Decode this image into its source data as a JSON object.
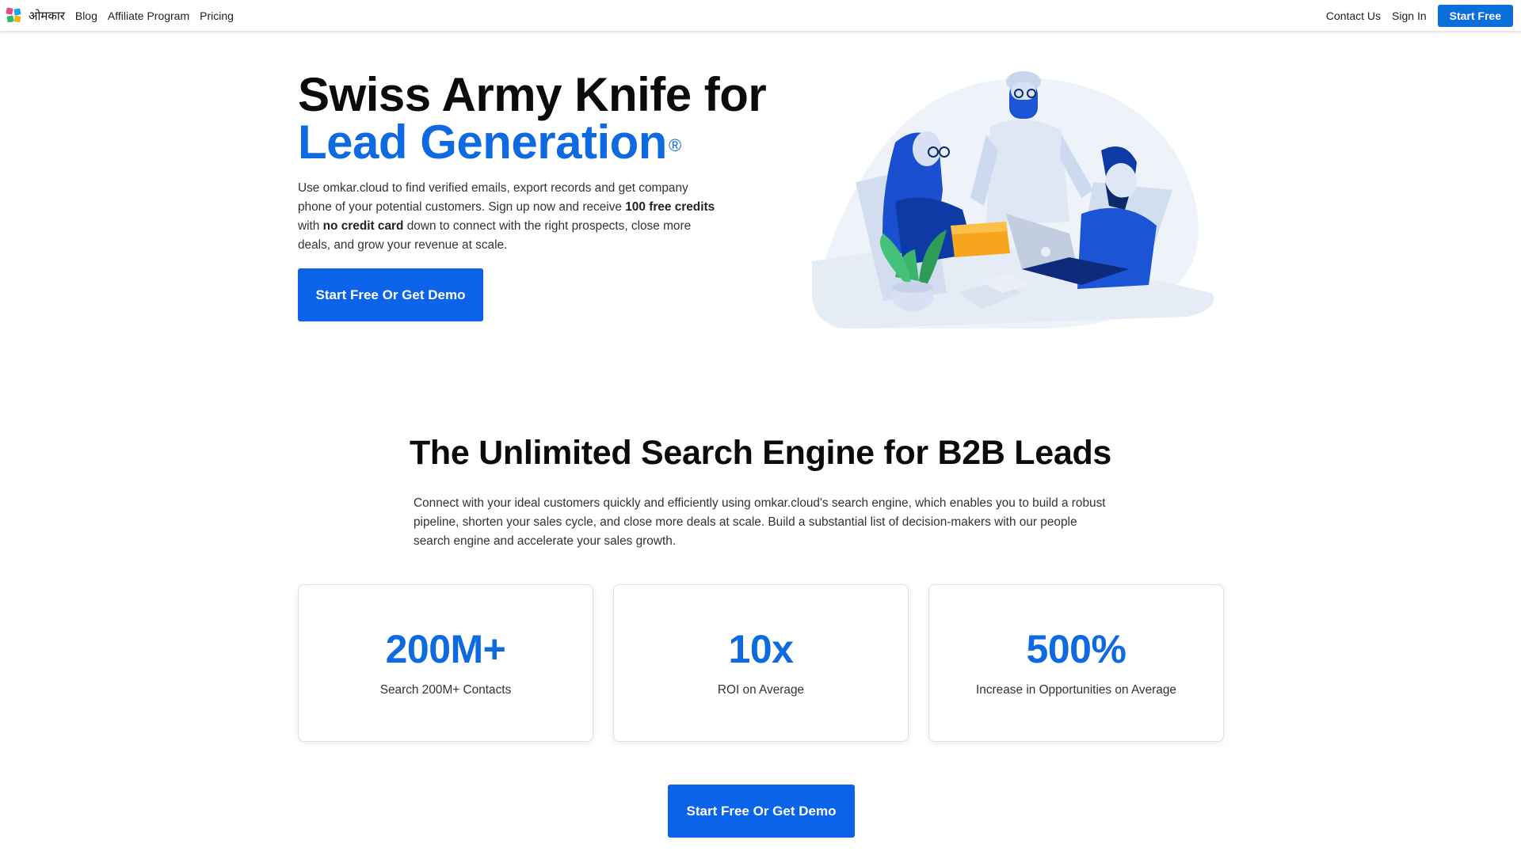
{
  "nav": {
    "brand": "ओमकार",
    "links": [
      "Blog",
      "Affiliate Program",
      "Pricing"
    ],
    "right_links": [
      "Contact Us",
      "Sign In"
    ],
    "cta": "Start Free"
  },
  "hero": {
    "title_line1": "Swiss Army Knife for",
    "title_line2": "Lead Generation",
    "trademark": "®",
    "desc_part1": "Use omkar.cloud to find verified emails, export records and get company phone of your potential customers. Sign up now and receive ",
    "desc_bold1": "100 free credits",
    "desc_part2": " with ",
    "desc_bold2": "no credit card",
    "desc_part3": " down to connect with the right prospects, close more deals, and grow your revenue at scale.",
    "cta": "Start Free Or Get Demo"
  },
  "section": {
    "title": "The Unlimited Search Engine for B2B Leads",
    "desc": "Connect with your ideal customers quickly and efficiently using omkar.cloud's search engine, which enables you to build a robust pipeline, shorten your sales cycle, and close more deals at scale. Build a substantial list of decision-makers with our people search engine and accelerate your sales growth.",
    "stats": [
      {
        "value": "200M+",
        "label": "Search 200M+ Contacts"
      },
      {
        "value": "10x",
        "label": "ROI on Average"
      },
      {
        "value": "500%",
        "label": "Increase in Opportunities on Average"
      }
    ],
    "cta": "Start Free Or Get Demo"
  },
  "colors": {
    "accent": "#0d6ae0",
    "button": "#0a63e8",
    "nav_button": "#0a6edb"
  },
  "icons": {
    "logo": "omkar-logo-icon",
    "illustration": "team-meeting-illustration"
  }
}
